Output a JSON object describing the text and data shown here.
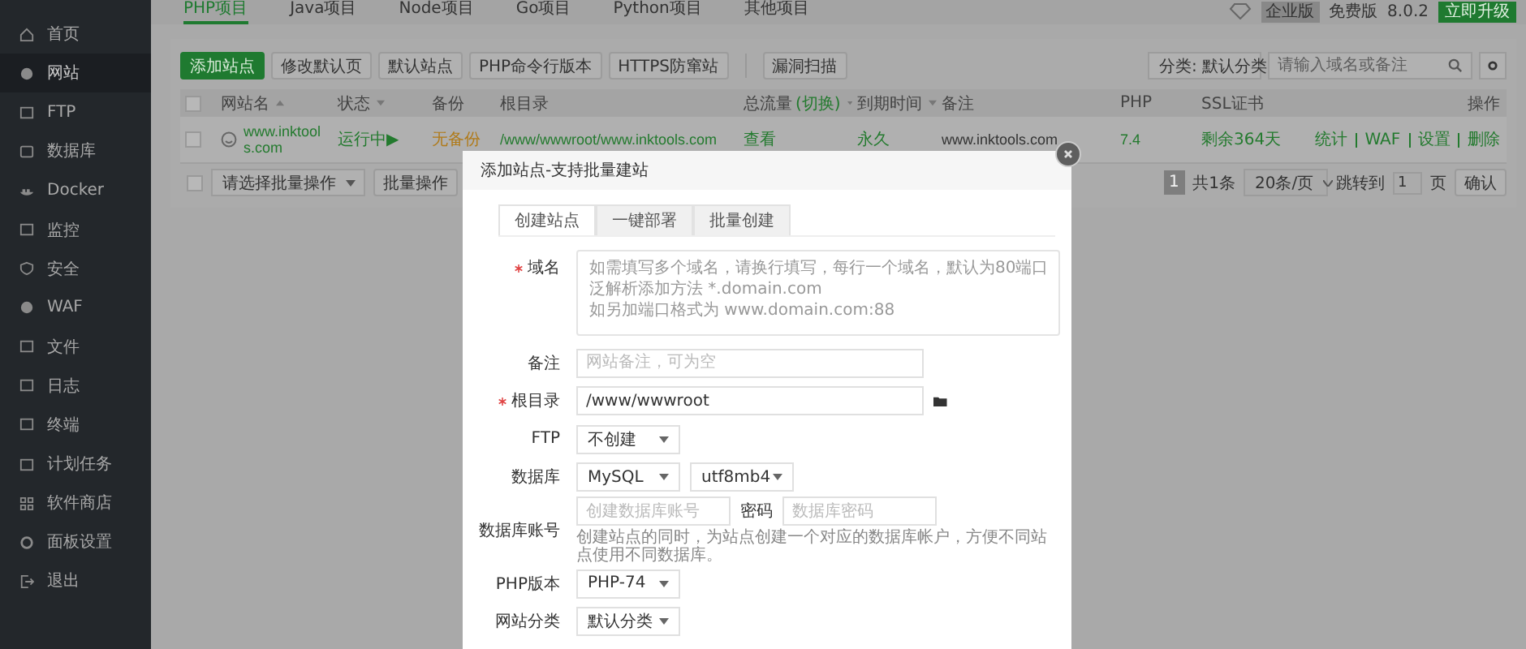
{
  "sidebar": {
    "items": [
      {
        "label": "首页",
        "selected": false
      },
      {
        "label": "网站",
        "selected": true
      },
      {
        "label": "FTP",
        "selected": false
      },
      {
        "label": "数据库",
        "selected": false
      },
      {
        "label": "Docker",
        "selected": false
      },
      {
        "label": "监控",
        "selected": false
      },
      {
        "label": "安全",
        "selected": false
      },
      {
        "label": "WAF",
        "selected": false
      },
      {
        "label": "文件",
        "selected": false
      },
      {
        "label": "日志",
        "selected": false
      },
      {
        "label": "终端",
        "selected": false
      },
      {
        "label": "计划任务",
        "selected": false
      },
      {
        "label": "软件商店",
        "selected": false
      },
      {
        "label": "面板设置",
        "selected": false
      },
      {
        "label": "退出",
        "selected": false
      }
    ]
  },
  "project_tabs": [
    {
      "label": "PHP项目",
      "selected": true
    },
    {
      "label": "Java项目",
      "selected": false
    },
    {
      "label": "Node项目",
      "selected": false
    },
    {
      "label": "Go项目",
      "selected": false
    },
    {
      "label": "Python项目",
      "selected": false
    },
    {
      "label": "其他项目",
      "selected": false
    }
  ],
  "header_right": {
    "edition_badge": "企业版",
    "edition": "免费版",
    "version": "8.0.2",
    "upgrade_button": "立即升级"
  },
  "toolbar": {
    "buttons": [
      {
        "label": "添加站点",
        "kind": "primary"
      },
      {
        "label": "修改默认页",
        "kind": "default"
      },
      {
        "label": "默认站点",
        "kind": "default"
      },
      {
        "label": "PHP命令行版本",
        "kind": "default"
      },
      {
        "label": "HTTPS防窜站",
        "kind": "default"
      },
      {
        "label": "漏洞扫描",
        "kind": "separated"
      }
    ],
    "category_select": "分类: 默认分类",
    "search": {
      "placeholder": "请输入域名或备注"
    }
  },
  "table": {
    "header_checkbox": {
      "checked": false
    },
    "columns": [
      {
        "label": "网站名",
        "kind": "sort-asc"
      },
      {
        "label": "状态",
        "kind": "sort-desc"
      },
      {
        "label": "备份",
        "kind": "plain"
      },
      {
        "label": "根目录",
        "kind": "plain"
      },
      {
        "label": "总流量",
        "switch_link": "(切换)",
        "kind": "sort-desc"
      },
      {
        "label": "到期时间",
        "kind": "sort-desc"
      },
      {
        "label": "备注",
        "kind": "plain"
      },
      {
        "label": "PHP",
        "kind": "plain"
      },
      {
        "label": "SSL证书",
        "kind": "plain"
      },
      {
        "label": "操作",
        "kind": "plain"
      }
    ],
    "rows": [
      {
        "checked": false,
        "name": "www.inktools.com",
        "status": "运行中▶",
        "backup": "无备份",
        "root": "/www/wwwroot/www.inktools.com",
        "traffic": "查看",
        "expiry": "永久",
        "note": "www.inktools.com",
        "php": "7.4",
        "ssl": "剩余364天",
        "actions": [
          "统计",
          "WAF",
          "设置",
          "删除"
        ]
      }
    ],
    "footer": {
      "checkbox": {
        "checked": false
      },
      "batch_select": "请选择批量操作",
      "batch_button": "批量操作",
      "pages": [
        {
          "label": "1",
          "selected": true
        }
      ],
      "total": "共1条",
      "page_size": "20条/页",
      "jump_label": "跳转到",
      "jump_value": "1",
      "page_unit": "页",
      "confirm": "确认"
    }
  },
  "modal": {
    "title": "添加站点-支持批量建站",
    "tabs": [
      {
        "label": "创建站点",
        "selected": true
      },
      {
        "label": "一键部署",
        "selected": false
      },
      {
        "label": "批量创建",
        "selected": false
      }
    ],
    "fields": [
      {
        "kind": "textarea",
        "label": "域名",
        "required": true,
        "placeholder_lines": [
          "如需填写多个域名，请换行填写，每行一个域名，默认为80端口",
          "泛解析添加方法 *.domain.com",
          "如另加端口格式为 www.domain.com:88"
        ]
      },
      {
        "kind": "input",
        "label": "备注",
        "required": false,
        "placeholder": "网站备注，可为空"
      },
      {
        "kind": "path",
        "label": "根目录",
        "required": true,
        "value": "/www/wwwroot"
      },
      {
        "kind": "select",
        "label": "FTP",
        "required": false,
        "values": [
          "不创建"
        ]
      },
      {
        "kind": "select",
        "label": "数据库",
        "required": false,
        "values": [
          "MySQL",
          "utf8mb4"
        ]
      },
      {
        "kind": "credentials",
        "label": "数据库账号",
        "required": false,
        "placeholder": "创建数据库账号",
        "password_label": "密码",
        "password_placeholder": "数据库密码",
        "help": "创建站点的同时，为站点创建一个对应的数据库帐户，方便不同站点使用不同数据库。"
      },
      {
        "kind": "select",
        "label": "PHP版本",
        "required": false,
        "values": [
          "PHP-74"
        ]
      },
      {
        "kind": "select",
        "label": "网站分类",
        "required": false,
        "values": [
          "默认分类"
        ]
      }
    ]
  }
}
